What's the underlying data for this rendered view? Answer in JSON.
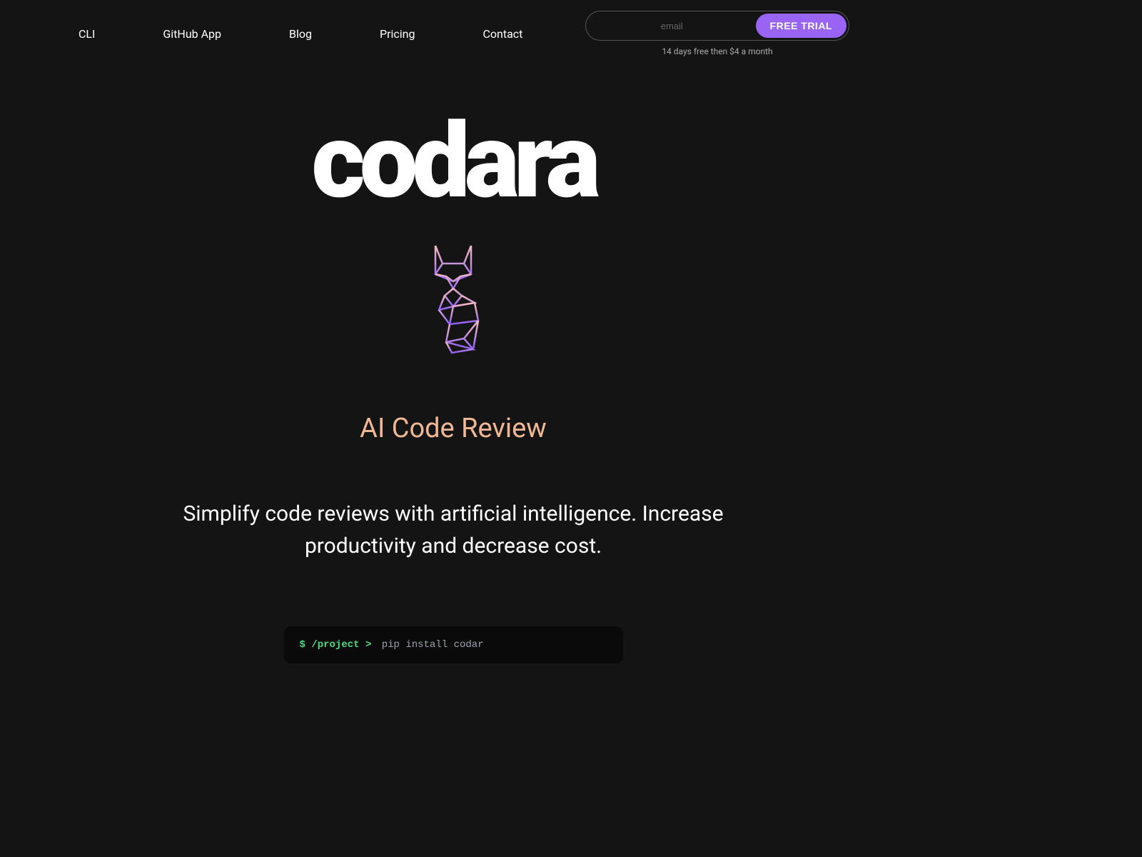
{
  "nav": {
    "links": [
      {
        "label": "CLI"
      },
      {
        "label": "GitHub App"
      },
      {
        "label": "Blog"
      },
      {
        "label": "Pricing"
      },
      {
        "label": "Contact"
      }
    ],
    "email_placeholder": "email",
    "trial_button": "FREE TRIAL",
    "pricing_note": "14 days free then $4 a month"
  },
  "hero": {
    "logo": "codara",
    "subtitle": "AI Code Review",
    "description": "Simplify code reviews with artificial intelligence. Increase productivity and decrease cost."
  },
  "terminal": {
    "prompt": "$",
    "path": "/project",
    "arrow": ">",
    "command": "pip install codar"
  }
}
